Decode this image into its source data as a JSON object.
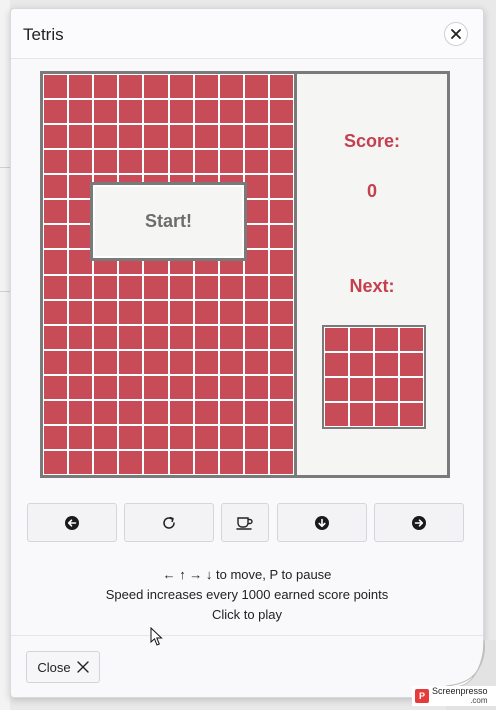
{
  "dialog": {
    "title": "Tetris"
  },
  "game": {
    "score_label": "Score:",
    "score_value": "0",
    "next_label": "Next:",
    "start_label": "Start!",
    "board_cols": 10,
    "board_rows": 16,
    "next_cols": 4,
    "next_rows": 4
  },
  "controls": [
    {
      "name": "move-left-button",
      "icon": "arrow-left-circle-icon"
    },
    {
      "name": "rotate-button",
      "icon": "rotate-icon"
    },
    {
      "name": "pause-button",
      "icon": "coffee-cup-icon"
    },
    {
      "name": "drop-button",
      "icon": "arrow-down-circle-icon"
    },
    {
      "name": "move-right-button",
      "icon": "arrow-right-circle-icon"
    }
  ],
  "help": {
    "line1": "← ↑ → ↓ to move, P to pause",
    "line2": "Speed increases every 1000 earned score points",
    "line3": "Click to play"
  },
  "footer": {
    "close_label": "Close"
  },
  "watermark": {
    "brand": "Screenpresso",
    "domain": ".com"
  },
  "colors": {
    "block": "#c84b58",
    "accent": "#c5404e",
    "frame": "#7a7a7a"
  }
}
